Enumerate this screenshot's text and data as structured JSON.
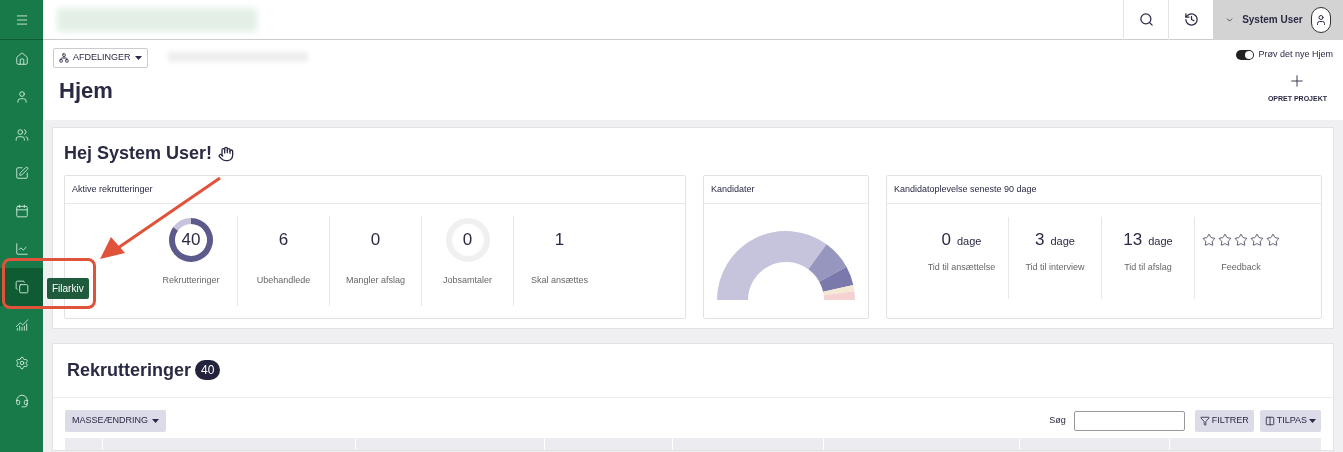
{
  "sidebar": {
    "items": [
      {
        "selected": false
      },
      {
        "selected": false
      },
      {
        "selected": false
      },
      {
        "selected": false
      },
      {
        "selected": false
      },
      {
        "selected": false
      },
      {
        "selected": false
      },
      {
        "selected": true,
        "tooltip": "Filarkiv"
      },
      {
        "selected": false
      },
      {
        "selected": false
      },
      {
        "selected": false
      }
    ]
  },
  "topbar": {
    "user": "System User"
  },
  "header": {
    "department_button": "AFDELINGER",
    "title": "Hjem",
    "toggle": {
      "label": "Prøv det nye Hjem",
      "on": true
    },
    "create_button": "OPRET PROJEKT"
  },
  "welcome": {
    "title": "Hej System User!",
    "active_recruitments": {
      "title": "Aktive rekrutteringer",
      "stats": [
        {
          "kind": "ring",
          "value": "40",
          "label": "Rekrutteringer"
        },
        {
          "kind": "plain",
          "value": "6",
          "label": "Ubehandlede"
        },
        {
          "kind": "plain",
          "value": "0",
          "label": "Mangler afslag"
        },
        {
          "kind": "empty_ring",
          "value": "0",
          "label": "Jobsamtaler"
        },
        {
          "kind": "plain",
          "value": "1",
          "label": "Skal ansættes"
        }
      ]
    },
    "candidates": {
      "title": "Kandidater"
    },
    "experience": {
      "title": "Kandidatoplevelse seneste 90 dage",
      "stats": [
        {
          "kind": "days",
          "value": "0",
          "unit": "dage",
          "label": "Tid til ansættelse"
        },
        {
          "kind": "days",
          "value": "3",
          "unit": "dage",
          "label": "Tid til interview"
        },
        {
          "kind": "days",
          "value": "13",
          "unit": "dage",
          "label": "Tid til afslag"
        },
        {
          "kind": "stars",
          "stars": 0,
          "label": "Feedback"
        }
      ]
    }
  },
  "recruitments": {
    "title": "Rekrutteringer",
    "count": "40",
    "bulk_button": "MASSEÆNDRING",
    "search_label": "Søg",
    "filter_button": "FILTRER",
    "customize_button": "TILPAS"
  }
}
